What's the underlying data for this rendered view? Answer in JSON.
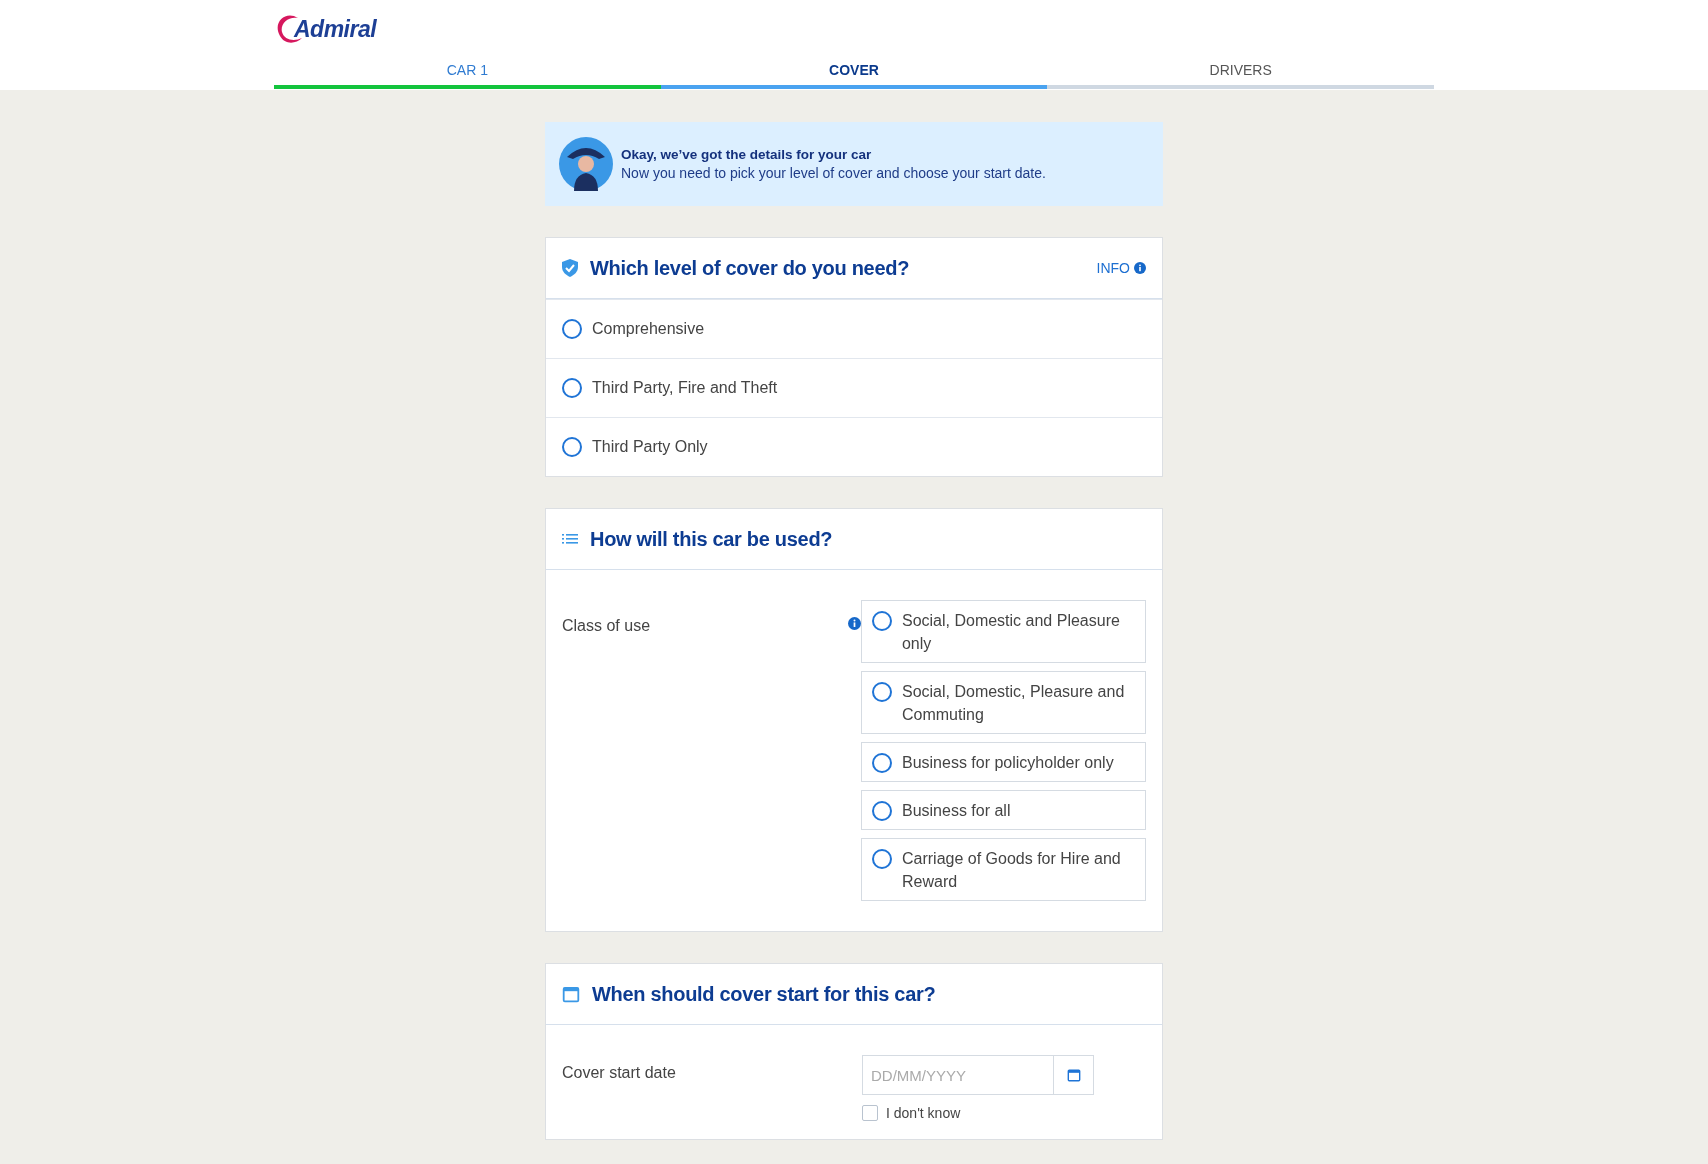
{
  "header": {
    "logo": "Admiral"
  },
  "steps": [
    {
      "label": "CAR 1",
      "completed": true,
      "selected": false
    },
    {
      "label": "COVER",
      "completed": false,
      "selected": true
    },
    {
      "label": "DRIVERS",
      "completed": false,
      "selected": false
    }
  ],
  "banner": {
    "title": "Okay, we’ve got the details for your car",
    "text": "Now you need to pick your level of cover and choose your start date."
  },
  "cover_level": {
    "title": "Which level of cover do you need?",
    "info": "INFO",
    "options": [
      {
        "label": "Comprehensive",
        "selected": false
      },
      {
        "label": "Third Party, Fire and Theft",
        "selected": false
      },
      {
        "label": "Third Party Only",
        "selected": false
      }
    ]
  },
  "usage": {
    "title": "How will this car be used?",
    "label": "Class of use",
    "options": [
      {
        "label": "Social, Domestic and Pleasure only",
        "selected": false
      },
      {
        "label": "Social, Domestic, Pleasure and Commuting",
        "selected": false
      },
      {
        "label": "Business for policyholder only",
        "selected": false
      },
      {
        "label": "Business for all",
        "selected": false
      },
      {
        "label": "Carriage of Goods for Hire and Reward",
        "selected": false
      }
    ]
  },
  "start": {
    "title": "When should cover start for this car?",
    "label": "Cover start date",
    "placeholder": "DD/MM/YYYY",
    "dont_know": {
      "label": "I don't know",
      "checked": false
    }
  }
}
